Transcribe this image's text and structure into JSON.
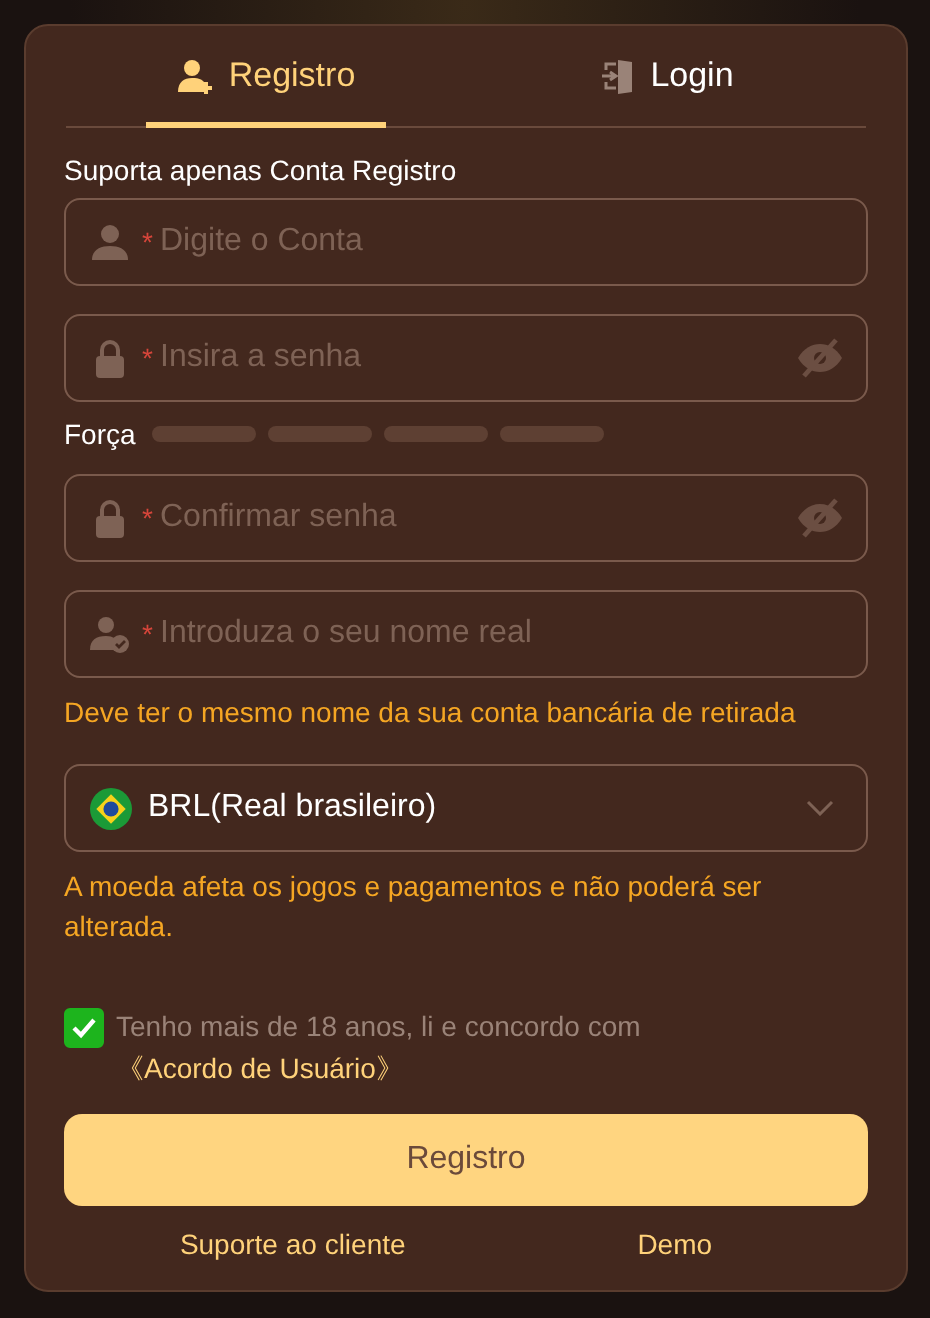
{
  "tabs": [
    {
      "label": "Registro",
      "selected": true
    },
    {
      "label": "Login",
      "selected": false
    }
  ],
  "form": {
    "note": "Suporta apenas Conta Registro",
    "fields": [
      {
        "kind": "account",
        "marker": "*",
        "placeholder": "Digite o Conta"
      },
      {
        "kind": "password",
        "marker": "*",
        "placeholder": "Insira a senha"
      },
      {
        "kind": "strength",
        "label": "Força"
      },
      {
        "kind": "password",
        "marker": "*",
        "placeholder": "Confirmar senha"
      },
      {
        "kind": "realname",
        "marker": "*",
        "placeholder": "Introduza o seu nome real",
        "hint": "Deve ter o mesmo nome da sua conta bancária de retirada"
      },
      {
        "kind": "currency",
        "value": "BRL(Real brasileiro)",
        "hint": "A moeda afeta os jogos e pagamentos e não poderá ser alterada."
      }
    ],
    "agreement": {
      "checked": true,
      "text": "Tenho mais de 18 anos, li e concordo com",
      "link": "《Acordo de Usuário》"
    },
    "submit": "Registro",
    "links": [
      "Suporte ao cliente",
      "Demo"
    ]
  }
}
